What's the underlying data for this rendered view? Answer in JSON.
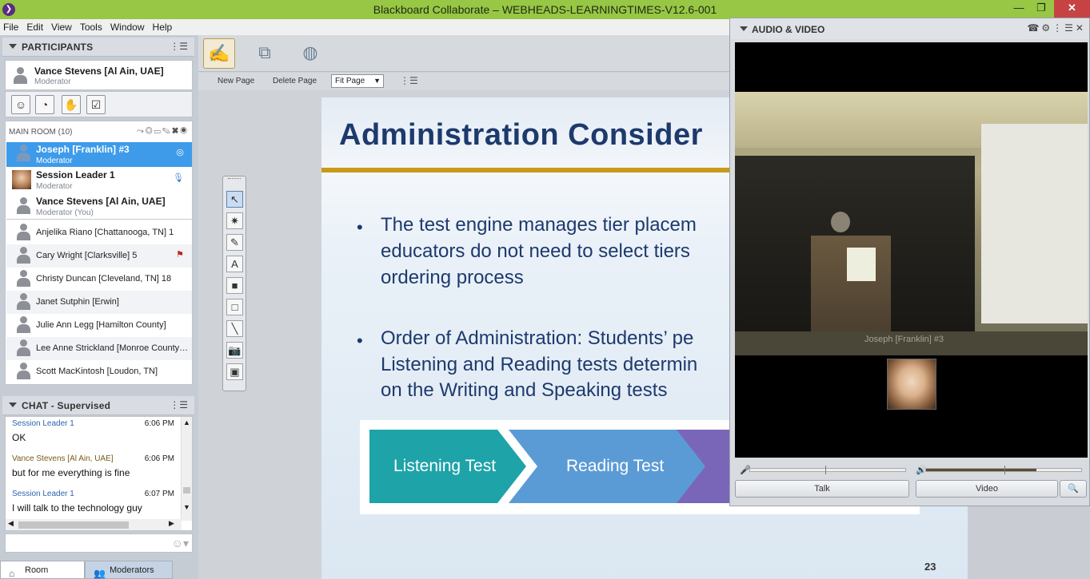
{
  "window": {
    "title": "Blackboard Collaborate – WEBHEADS-LEARNINGTIMES-V12.6-001",
    "minimize": "—",
    "maximize": "❐",
    "close": "✕"
  },
  "menu": [
    "File",
    "Edit",
    "View",
    "Tools",
    "Window",
    "Help"
  ],
  "participants_panel": {
    "title": "PARTICIPANTS",
    "me": {
      "name": "Vance Stevens [Al Ain, UAE]",
      "role": "Moderator"
    },
    "status_buttons": [
      "smiley-icon",
      "away-icon",
      "raise-hand-icon",
      "polling-checkbox-icon"
    ],
    "room": {
      "label": "MAIN ROOM",
      "count": "(10)"
    },
    "moderators": [
      {
        "name": "Joseph [Franklin] #3",
        "role": "Moderator",
        "selected": true
      },
      {
        "name": "Session Leader 1",
        "role": "Moderator",
        "selected": false
      },
      {
        "name": "Vance Stevens [Al Ain, UAE]",
        "role": "Moderator (You)",
        "selected": false
      }
    ],
    "participants": [
      "Anjelika Riano [Chattanooga, TN] 1",
      "Cary Wright [Clarksville] 5",
      "Christy Duncan [Cleveland, TN] 18",
      "Janet Sutphin [Erwin]",
      "Julie Ann Legg [Hamilton County]",
      "Lee Anne Strickland [Monroe County…",
      "Scott MacKintosh [Loudon, TN]"
    ]
  },
  "chat": {
    "title": "CHAT - Supervised",
    "messages": [
      {
        "author": "Session Leader 1",
        "time": "6:06 PM",
        "text": "OK"
      },
      {
        "author": "Vance Stevens [Al Ain, UAE]",
        "time": "6:06 PM",
        "text": "but for me everything is fine"
      },
      {
        "author": "Session Leader 1",
        "time": "6:07 PM",
        "text": "I will talk to the technology guy"
      }
    ]
  },
  "bottom_tabs": {
    "room": "Room",
    "moderators": "Moderators"
  },
  "whiteboard": {
    "page_toolbar": {
      "new_page": "New Page",
      "delete_page": "Delete Page",
      "zoom": "Fit Page"
    },
    "slide": {
      "title": "Administration Consider",
      "bullets": [
        [
          "The test engine manages tier placem",
          "educators do not need to select tiers",
          "ordering process"
        ],
        [
          "Order of Administration: Students’ pe",
          "Listening and Reading tests determin",
          "on the Writing and Speaking tests"
        ]
      ],
      "steps": [
        "Listening Test",
        "Reading Test"
      ],
      "step_colors": [
        "#1ea3a8",
        "#5b9bd5",
        "#7a66b8"
      ],
      "page_number": "23"
    }
  },
  "audio_video": {
    "title": "AUDIO & VIDEO",
    "video_caption": "Joseph [Franklin] #3",
    "talk_button": "Talk",
    "video_button": "Video"
  }
}
